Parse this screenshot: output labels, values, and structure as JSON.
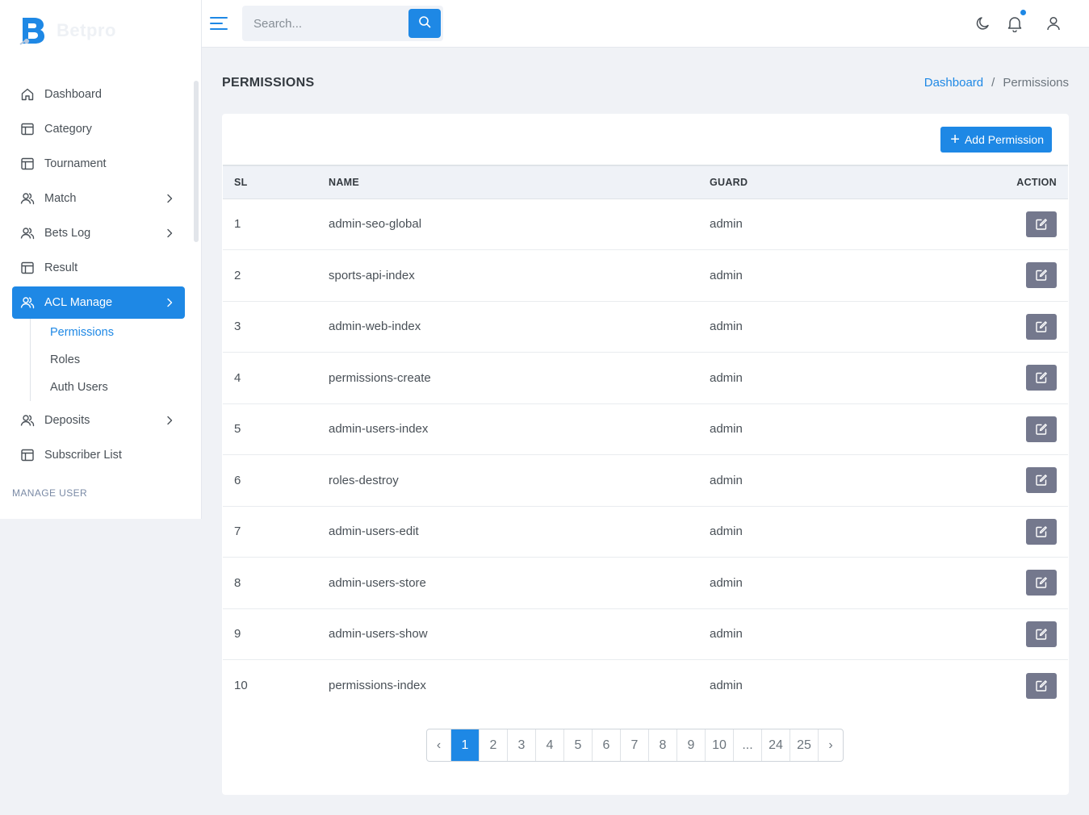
{
  "brand": {
    "name": "Betpro",
    "accent": "#1e88e5"
  },
  "sidebar": {
    "items": [
      {
        "label": "Dashboard",
        "icon": "home-icon"
      },
      {
        "label": "Category",
        "icon": "table-icon"
      },
      {
        "label": "Tournament",
        "icon": "table-icon"
      },
      {
        "label": "Match",
        "icon": "users-icon",
        "has_children": true
      },
      {
        "label": "Bets Log",
        "icon": "users-icon",
        "has_children": true
      },
      {
        "label": "Result",
        "icon": "table-icon"
      },
      {
        "label": "ACL Manage",
        "icon": "users-icon",
        "has_children": true,
        "active": true
      },
      {
        "label": "Deposits",
        "icon": "users-icon",
        "has_children": true
      },
      {
        "label": "Subscriber List",
        "icon": "table-icon"
      }
    ],
    "acl_submenu": [
      {
        "label": "Permissions",
        "active": true
      },
      {
        "label": "Roles"
      },
      {
        "label": "Auth Users"
      }
    ],
    "section_label": "MANAGE USER"
  },
  "topbar": {
    "search_placeholder": "Search...",
    "icons": [
      "menu-icon",
      "search-icon",
      "moon-icon",
      "bell-icon",
      "user-icon"
    ]
  },
  "page": {
    "title": "PERMISSIONS",
    "breadcrumb": {
      "home": "Dashboard",
      "separator": "/",
      "current": "Permissions"
    }
  },
  "card": {
    "add_button_label": "Add Permission",
    "table": {
      "headers": {
        "sl": "SL",
        "name": "NAME",
        "guard": "GUARD",
        "action": "ACTION"
      },
      "rows": [
        {
          "sl": "1",
          "name": "admin-seo-global",
          "guard": "admin"
        },
        {
          "sl": "2",
          "name": "sports-api-index",
          "guard": "admin"
        },
        {
          "sl": "3",
          "name": "admin-web-index",
          "guard": "admin"
        },
        {
          "sl": "4",
          "name": "permissions-create",
          "guard": "admin"
        },
        {
          "sl": "5",
          "name": "admin-users-index",
          "guard": "admin"
        },
        {
          "sl": "6",
          "name": "roles-destroy",
          "guard": "admin"
        },
        {
          "sl": "7",
          "name": "admin-users-edit",
          "guard": "admin"
        },
        {
          "sl": "8",
          "name": "admin-users-store",
          "guard": "admin"
        },
        {
          "sl": "9",
          "name": "admin-users-show",
          "guard": "admin"
        },
        {
          "sl": "10",
          "name": "permissions-index",
          "guard": "admin"
        }
      ]
    },
    "pagination": {
      "prev": "‹",
      "next": "›",
      "pages": [
        "1",
        "2",
        "3",
        "4",
        "5",
        "6",
        "7",
        "8",
        "9",
        "10",
        "...",
        "24",
        "25"
      ],
      "current": "1"
    }
  }
}
